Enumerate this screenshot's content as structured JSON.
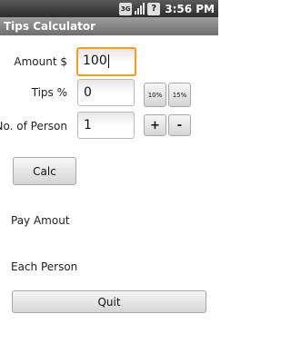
{
  "status_bar": {
    "network_label": "3G",
    "clock": "3:56 PM"
  },
  "app": {
    "title": "Tips Calculator"
  },
  "form": {
    "amount_label": "Amount $",
    "amount_value": "100",
    "tips_label": "Tips %",
    "tips_value": "0",
    "tip_10_label": "10%",
    "tip_15_label": "15%",
    "persons_label": "No. of Person",
    "persons_value": "1",
    "plus_label": "+",
    "minus_label": "-",
    "calc_label": "Calc"
  },
  "results": {
    "pay_amount_label": "Pay Amout",
    "each_person_label": "Each Person"
  },
  "footer": {
    "quit_label": "Quit"
  }
}
